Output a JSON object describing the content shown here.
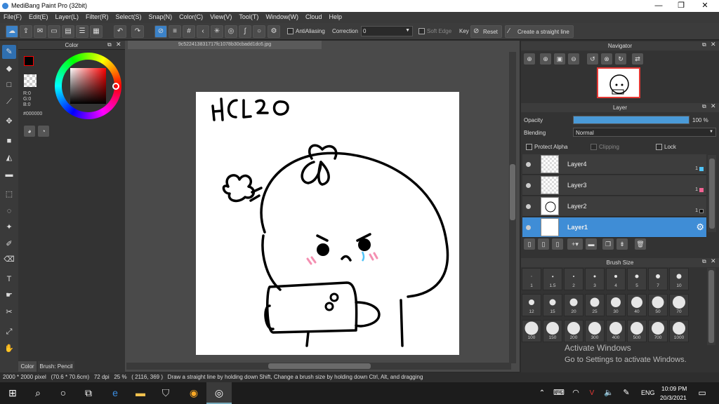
{
  "window": {
    "title": "MediBang Paint Pro (32bit)",
    "min": "—",
    "max": "❐",
    "close": "✕"
  },
  "menu": [
    "File(F)",
    "Edit(E)",
    "Layer(L)",
    "Filter(R)",
    "Select(S)",
    "Snap(N)",
    "Color(C)",
    "View(V)",
    "Tool(T)",
    "Window(W)",
    "Cloud",
    "Help"
  ],
  "toolbar": {
    "antialias": "AntiAliasing",
    "correction_label": "Correction",
    "correction_value": "0",
    "soft_edge": "Soft Edge",
    "key": "Key",
    "reset": "Reset",
    "straight": "Create a straight line"
  },
  "color_panel": {
    "title": "Color",
    "r": "R:0",
    "g": "G:0",
    "b": "B:0",
    "hex": "#000000",
    "tab_color": "Color",
    "tab_brush": "Brush: Pencil"
  },
  "document": {
    "tab": "9c522413831717fc1078b30cbadd1dc6.jpg"
  },
  "navigator": {
    "title": "Navigator"
  },
  "layer_panel": {
    "title": "Layer",
    "opacity_label": "Opacity",
    "opacity_value": "100 %",
    "opacity": 1.0,
    "blending_label": "Blending",
    "blending_value": "Normal",
    "protect_alpha": "Protect Alpha",
    "clipping": "Clipping",
    "lock": "Lock",
    "layers": [
      {
        "name": "Layer4",
        "num": "1",
        "color": "#4fc3f7"
      },
      {
        "name": "Layer3",
        "num": "1",
        "color": "#f06292"
      },
      {
        "name": "Layer2",
        "num": "1",
        "color": "#000000"
      },
      {
        "name": "Layer1",
        "num": "",
        "color": ""
      }
    ]
  },
  "brush_panel": {
    "title": "Brush Size",
    "sizes": [
      "1",
      "1.5",
      "2",
      "3",
      "4",
      "5",
      "7",
      "10",
      "12",
      "15",
      "20",
      "25",
      "30",
      "40",
      "50",
      "70",
      "100",
      "150",
      "200",
      "300",
      "400",
      "500",
      "700",
      "1000"
    ]
  },
  "status": {
    "text": "2000 * 2000 pixel   (70.6 * 70.6cm)   72 dpi   25 %   ( 2116, 369 )   Draw a straight line by holding down Shift, Change a brush size by holding down Ctrl, Alt, and dragging"
  },
  "watermark": {
    "line1": "Activate Windows",
    "line2": "Go to Settings to activate Windows."
  },
  "taskbar": {
    "lang": "ENG",
    "time": "10:09 PM",
    "date": "20/3/2021"
  },
  "drawing": {
    "text": "HCL20"
  },
  "colors": {
    "accent": "#3f8dd6",
    "bg": "#2b2b2b",
    "panel": "#333333"
  }
}
